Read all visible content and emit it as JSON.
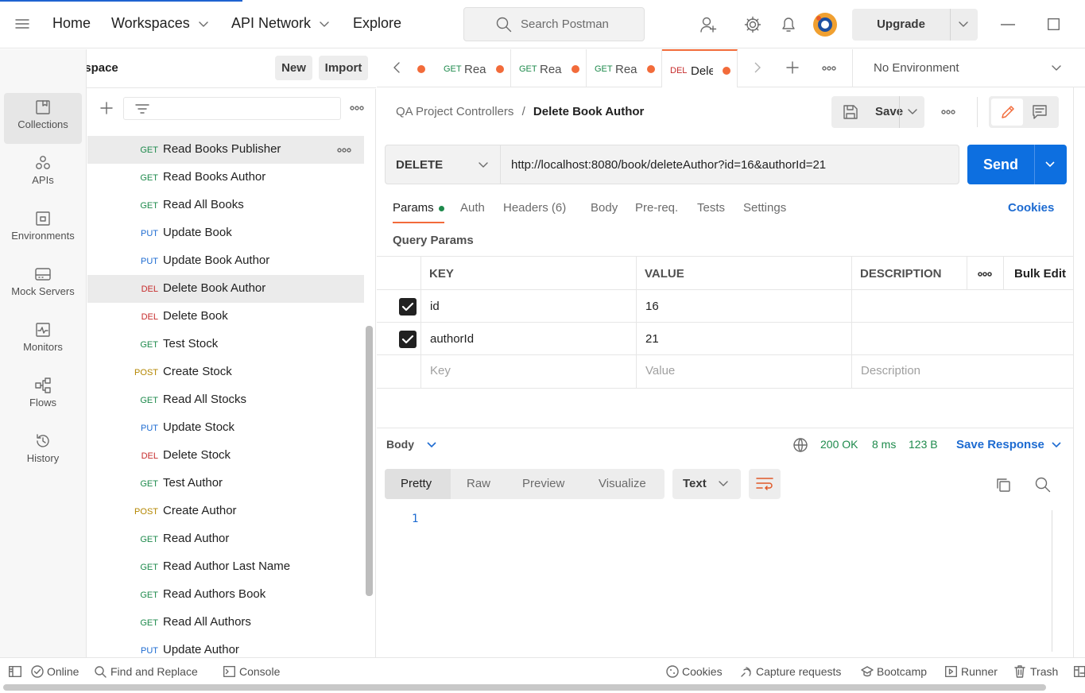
{
  "topbar": {
    "nav": [
      "Home",
      "Workspaces",
      "API Network",
      "Explore"
    ],
    "search_placeholder": "Search Postman",
    "upgrade_label": "Upgrade"
  },
  "workspace": {
    "title": "My Workspace",
    "new_label": "New",
    "import_label": "Import"
  },
  "rail": [
    {
      "label": "Collections",
      "icon": "collections-icon"
    },
    {
      "label": "APIs",
      "icon": "apis-icon"
    },
    {
      "label": "Environments",
      "icon": "environments-icon"
    },
    {
      "label": "Mock Servers",
      "icon": "mock-servers-icon"
    },
    {
      "label": "Monitors",
      "icon": "monitors-icon"
    },
    {
      "label": "Flows",
      "icon": "flows-icon"
    },
    {
      "label": "History",
      "icon": "history-icon"
    }
  ],
  "requests": [
    {
      "method": "GET",
      "name": "Read Books Publisher"
    },
    {
      "method": "GET",
      "name": "Read Books Author"
    },
    {
      "method": "GET",
      "name": "Read All Books"
    },
    {
      "method": "PUT",
      "name": "Update Book"
    },
    {
      "method": "PUT",
      "name": "Update Book Author"
    },
    {
      "method": "DEL",
      "name": "Delete Book Author"
    },
    {
      "method": "DEL",
      "name": "Delete Book"
    },
    {
      "method": "GET",
      "name": "Test Stock"
    },
    {
      "method": "POST",
      "name": "Create Stock"
    },
    {
      "method": "GET",
      "name": "Read All Stocks"
    },
    {
      "method": "PUT",
      "name": "Update Stock"
    },
    {
      "method": "DEL",
      "name": "Delete Stock"
    },
    {
      "method": "GET",
      "name": "Test Author"
    },
    {
      "method": "POST",
      "name": "Create Author"
    },
    {
      "method": "GET",
      "name": "Read Author"
    },
    {
      "method": "GET",
      "name": "Read Author Last Name"
    },
    {
      "method": "GET",
      "name": "Read Authors Book"
    },
    {
      "method": "GET",
      "name": "Read All Authors"
    },
    {
      "method": "PUT",
      "name": "Update Author"
    }
  ],
  "tabs": [
    {
      "method": "GET",
      "name": "Read"
    },
    {
      "method": "GET",
      "name": "Read"
    },
    {
      "method": "GET",
      "name": "Read"
    },
    {
      "method": "DEL",
      "name": "Dele"
    }
  ],
  "environment": "No Environment",
  "breadcrumb": {
    "collection": "QA Project Controllers",
    "separator": "/",
    "request": "Delete Book Author"
  },
  "save_label": "Save",
  "request": {
    "method": "DELETE",
    "url": "http://localhost:8080/book/deleteAuthor?id=16&authorId=21",
    "send_label": "Send",
    "tabs": [
      "Params",
      "Auth",
      "Headers (6)",
      "Body",
      "Pre-req.",
      "Tests",
      "Settings"
    ],
    "cookies_label": "Cookies",
    "query_params_label": "Query Params"
  },
  "params_table": {
    "headers": [
      "KEY",
      "VALUE",
      "DESCRIPTION"
    ],
    "bulk_edit": "Bulk Edit",
    "rows": [
      {
        "key": "id",
        "value": "16",
        "checked": true
      },
      {
        "key": "authorId",
        "value": "21",
        "checked": true
      }
    ],
    "placeholders": {
      "key": "Key",
      "value": "Value",
      "description": "Description"
    }
  },
  "response": {
    "body_label": "Body",
    "status": "200 OK",
    "time": "8 ms",
    "size": "123 B",
    "save_label": "Save Response",
    "view_tabs": [
      "Pretty",
      "Raw",
      "Preview",
      "Visualize"
    ],
    "format": "Text",
    "line_number": "1"
  },
  "statusbar": {
    "online": "Online",
    "find_replace": "Find and Replace",
    "console": "Console",
    "cookies": "Cookies",
    "capture": "Capture requests",
    "bootcamp": "Bootcamp",
    "runner": "Runner",
    "trash": "Trash"
  },
  "colors": {
    "accent": "#f26b3a",
    "primary": "#0d6fe0",
    "get": "#1e8a4c",
    "put": "#1d6bd1",
    "del": "#c62b2b",
    "post": "#b38600"
  }
}
